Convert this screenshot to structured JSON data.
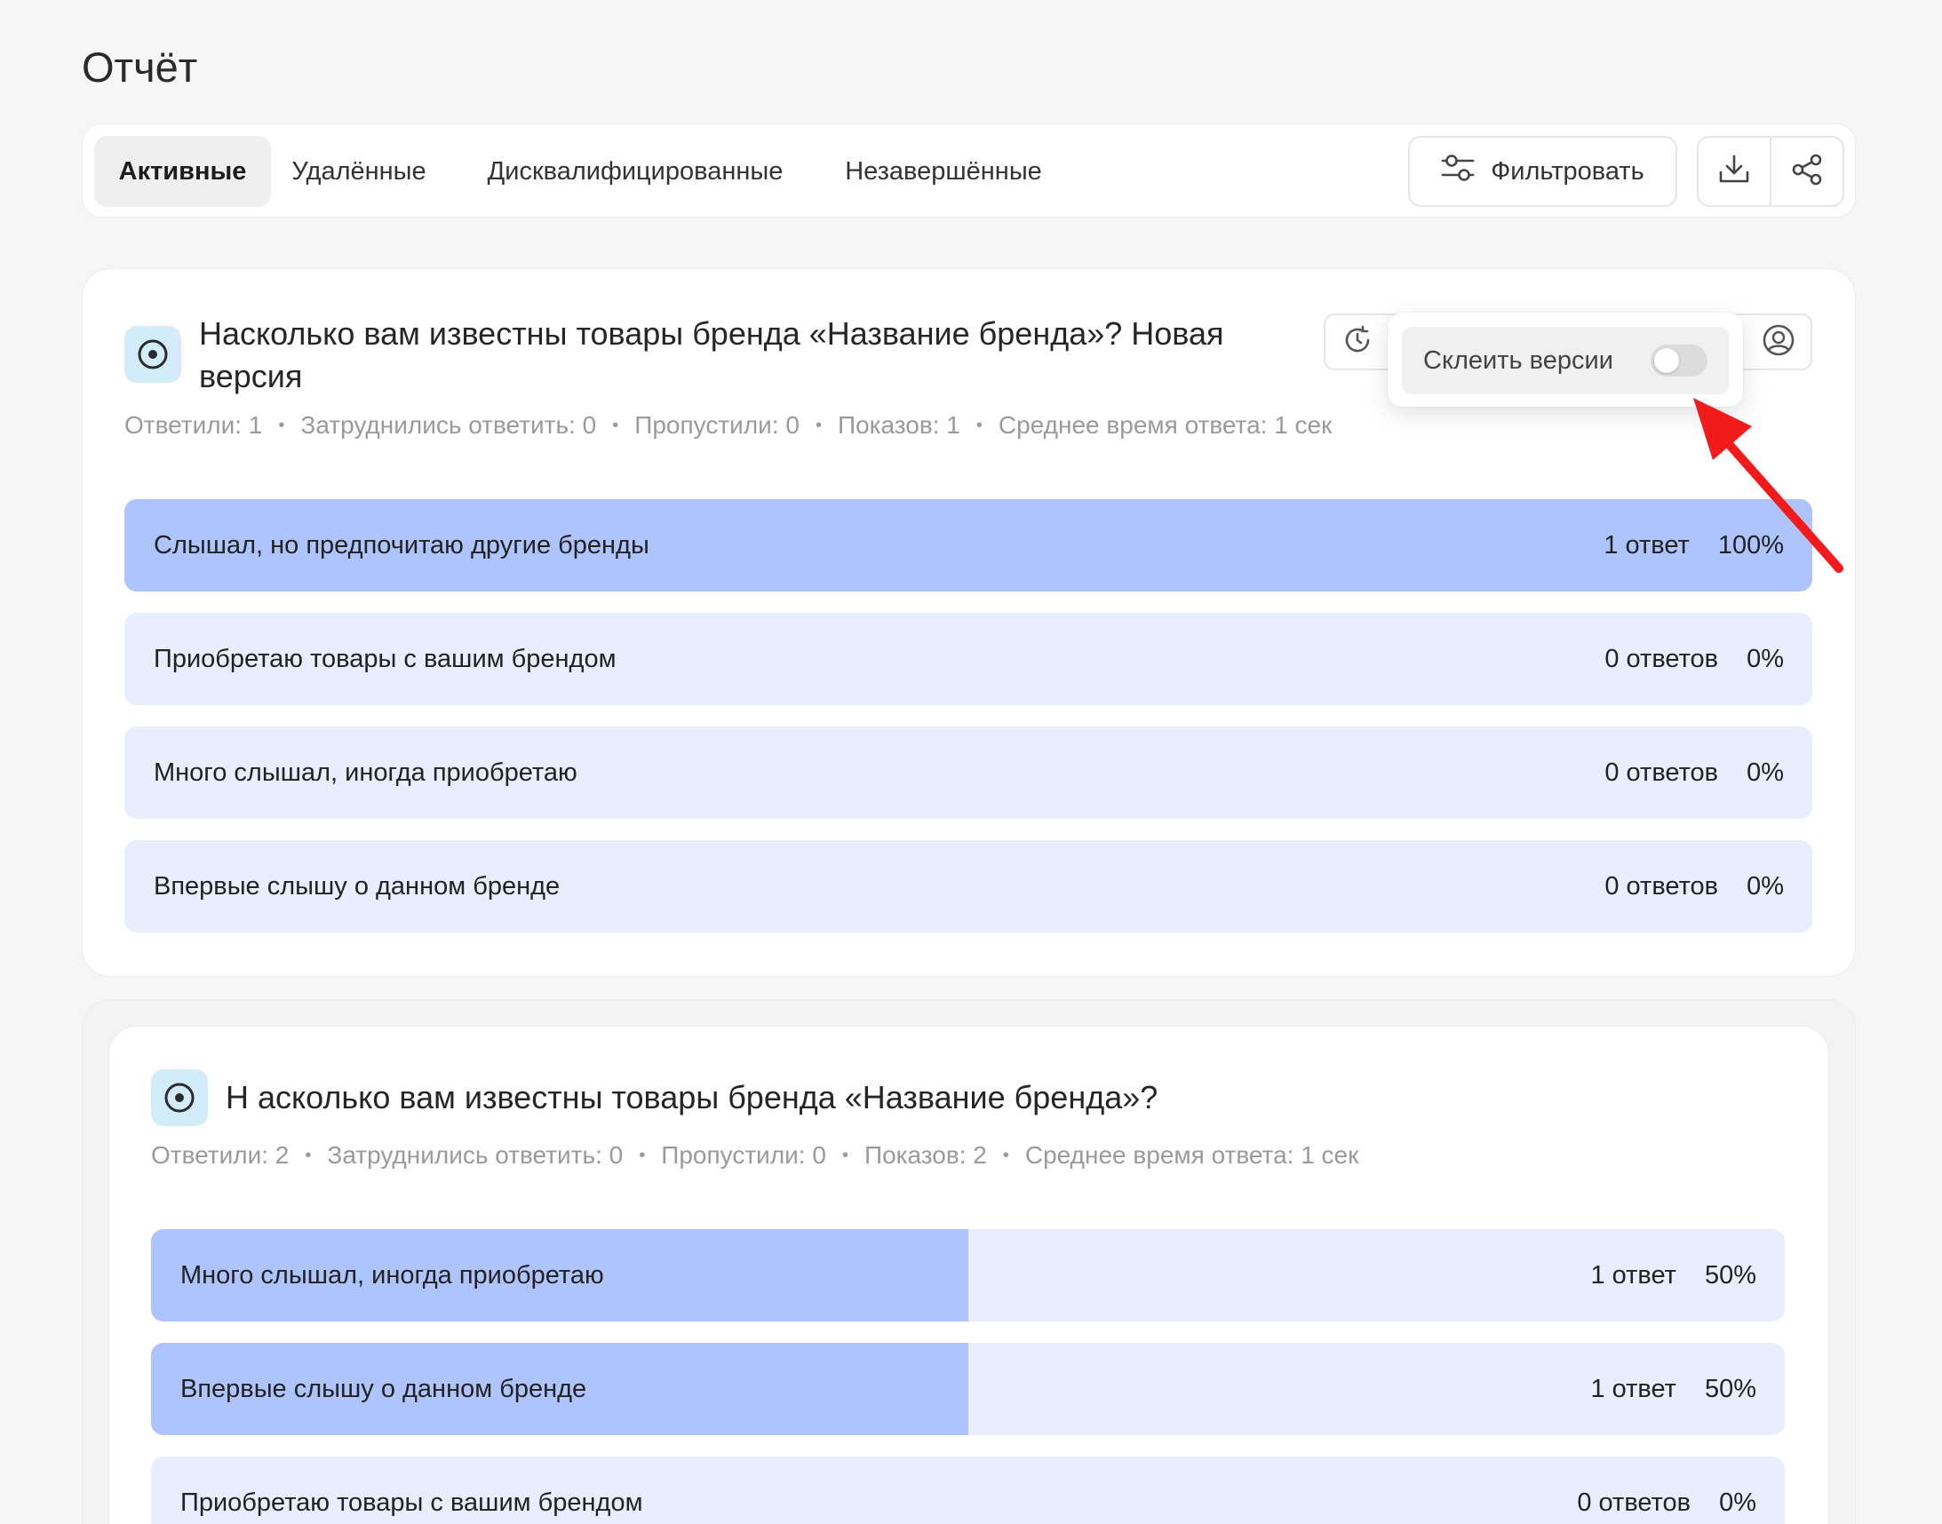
{
  "page": {
    "title": "Отчёт"
  },
  "tabs": [
    {
      "label": "Активные",
      "active": true
    },
    {
      "label": "Удалённые",
      "active": false
    },
    {
      "label": "Дисквалифицированные",
      "active": false
    },
    {
      "label": "Незавершённые",
      "active": false
    }
  ],
  "toolbar": {
    "filter_label": "Фильтровать"
  },
  "popover": {
    "merge_label": "Склеить версии",
    "merge_enabled": false
  },
  "questions": [
    {
      "title_line1": "Насколько вам известны товары бренда «Название бренда»? Новая",
      "title_line2": "версия",
      "stats": [
        "Ответили: 1",
        "Затруднились ответить: 0",
        "Пропустили: 0",
        "Показов: 1",
        "Среднее время ответа: 1 сек"
      ],
      "answers": [
        {
          "label": "Слышал, но предпочитаю другие бренды",
          "count": "1 ответ",
          "percent": "100%",
          "share": 1.0
        },
        {
          "label": "Приобретаю товары с вашим брендом",
          "count": "0 ответов",
          "percent": "0%",
          "share": 0
        },
        {
          "label": "Много слышал, иногда приобретаю",
          "count": "0 ответов",
          "percent": "0%",
          "share": 0
        },
        {
          "label": "Впервые слышу о данном бренде",
          "count": "0 ответов",
          "percent": "0%",
          "share": 0
        }
      ]
    },
    {
      "title_line1": "Н асколько вам известны товары бренда «Название бренда»?",
      "stats": [
        "Ответили: 2",
        "Затруднились ответить: 0",
        "Пропустили: 0",
        "Показов: 2",
        "Среднее время ответа: 1 сек"
      ],
      "answers": [
        {
          "label": "Много слышал, иногда приобретаю",
          "count": "1 ответ",
          "percent": "50%",
          "share": 0.5
        },
        {
          "label": "Впервые слышу о данном бренде",
          "count": "1 ответ",
          "percent": "50%",
          "share": 0.5
        },
        {
          "label": "Приобретаю товары с вашим брендом",
          "count": "0 ответов",
          "percent": "0%",
          "share": 0
        }
      ]
    }
  ],
  "colors": {
    "bar_fill": "#aec4fd",
    "bar_track": "#e8eefe",
    "icon_bg": "#d3ecfb",
    "arrow": "#f21a1a"
  }
}
